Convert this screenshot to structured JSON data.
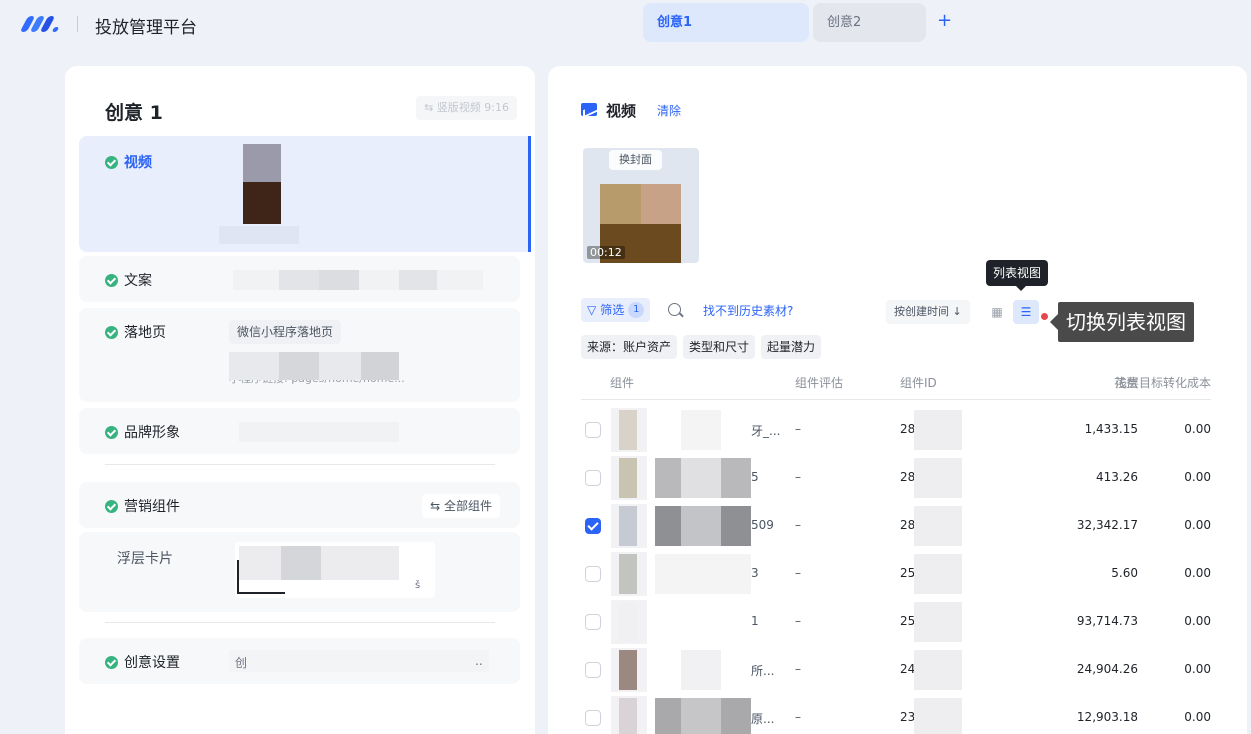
{
  "app": {
    "title": "投放管理平台"
  },
  "tabs": [
    {
      "label": "创意1",
      "active": true
    },
    {
      "label": "创意2",
      "active": false
    }
  ],
  "tab_add": "+",
  "left": {
    "title": "创意 1",
    "orientation_badge": "⇆ 竖版视频 9:16",
    "sections": {
      "video": "视频",
      "copy": "文案",
      "landing": "落地页",
      "landing_type": "微信小程序落地页",
      "landing_path": "小程序链接: pages/home/home...",
      "brand": "品牌形象",
      "marketing": "营销组件",
      "all_components": "⇆ 全部组件",
      "float_card": "浮层卡片",
      "float_card_suffix": "š",
      "settings": "创意设置",
      "settings_value": "创",
      "settings_ellipsis": ".."
    }
  },
  "right": {
    "section_title": "视频",
    "clear": "清除",
    "thumb": {
      "cover_button": "换封面",
      "duration": "00:12"
    },
    "filter": {
      "label": "筛选",
      "count": "1"
    },
    "history_link": "找不到历史素材?",
    "sort": "按创建时间 ↓",
    "view_grid_icon": "▦",
    "view_list_icon": "☰",
    "tooltip": "列表视图",
    "callout": "切换列表视图",
    "tags": [
      "来源：账户资产",
      "类型和尺寸",
      "起量潜力"
    ],
    "columns": [
      "组件",
      "组件评估",
      "组件ID",
      "花费",
      "浅层目标转化成本"
    ],
    "rows": [
      {
        "name_tail": "牙_...",
        "eval": "–",
        "id": "28",
        "cost": "1,433.15",
        "conv_cost": "0.00",
        "checked": false
      },
      {
        "name_tail": "5",
        "eval": "–",
        "id": "28",
        "cost": "413.26",
        "conv_cost": "0.00",
        "checked": false
      },
      {
        "name_tail": "509",
        "eval": "–",
        "id": "28",
        "cost": "32,342.17",
        "conv_cost": "0.00",
        "checked": true
      },
      {
        "name_tail": "3",
        "eval": "–",
        "id": "25",
        "cost": "5.60",
        "conv_cost": "0.00",
        "checked": false
      },
      {
        "name_tail": "1",
        "eval": "–",
        "id": "25",
        "cost": "93,714.73",
        "conv_cost": "0.00",
        "checked": false
      },
      {
        "name_tail": "所...",
        "eval": "–",
        "id": "24",
        "cost": "24,904.26",
        "conv_cost": "0.00",
        "checked": false
      },
      {
        "name_tail": "原...",
        "eval": "–",
        "id": "23",
        "cost": "12,903.18",
        "conv_cost": "0.00",
        "checked": false
      }
    ]
  },
  "colors": {
    "accent": "#2b63f6",
    "success": "#36b37e",
    "alert": "#e5484d"
  }
}
